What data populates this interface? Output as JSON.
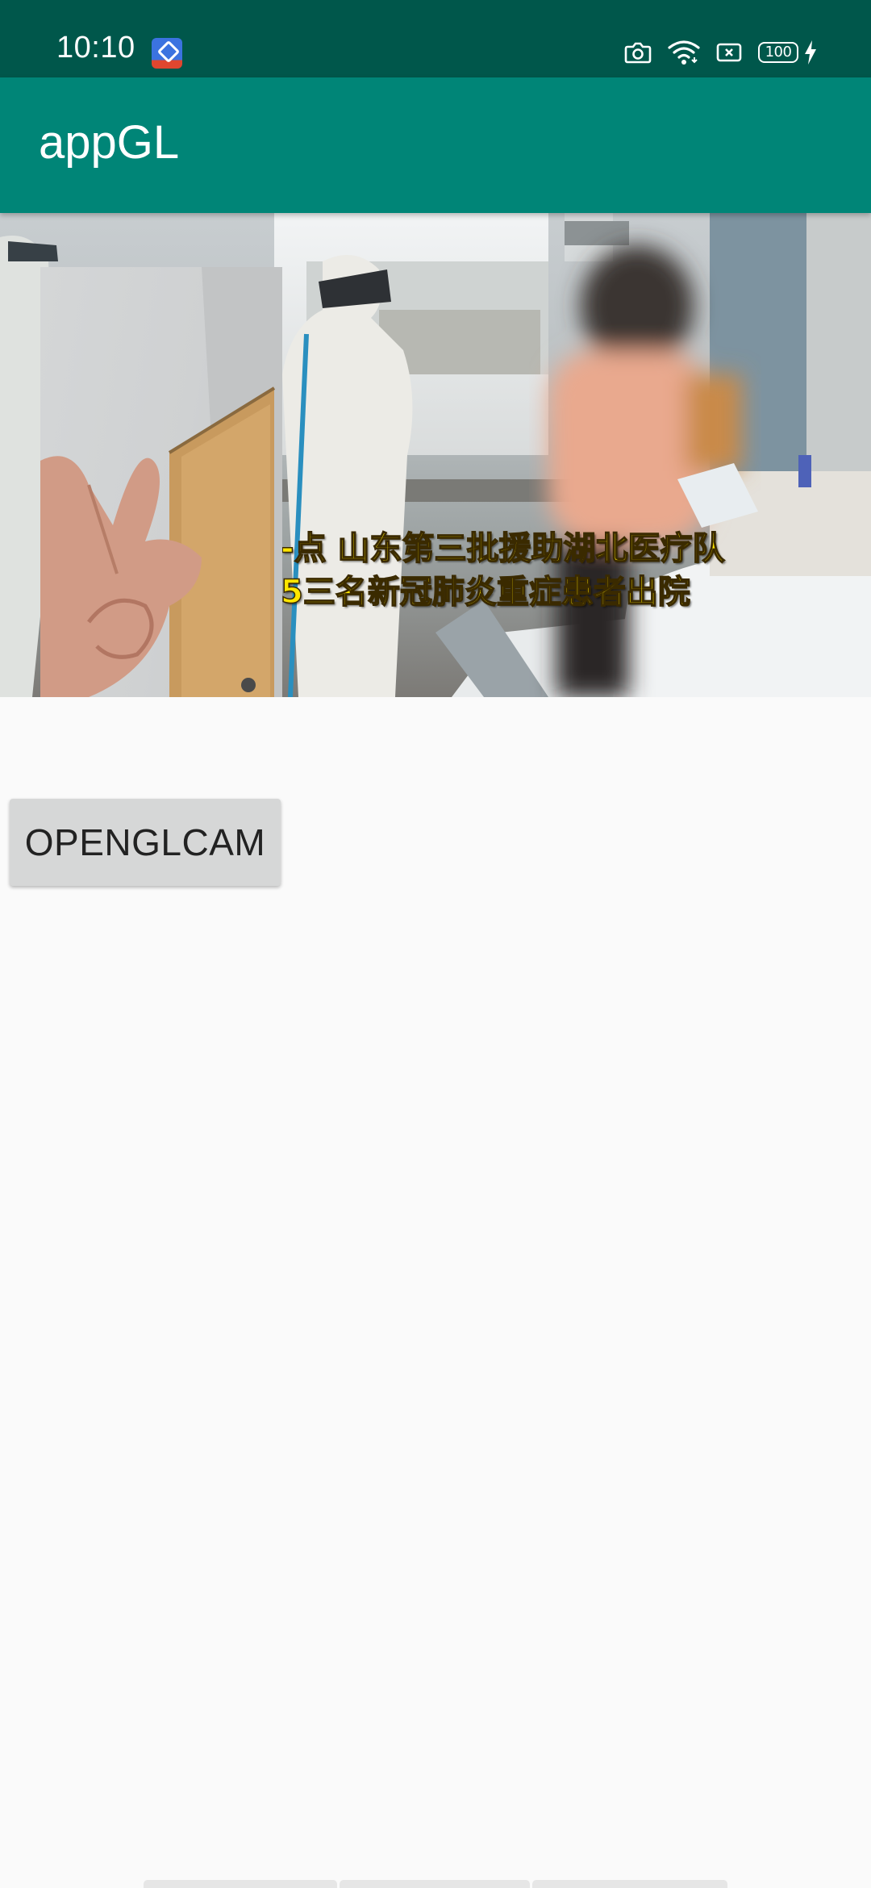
{
  "status_bar": {
    "time": "10:10",
    "notification_icon": "app-notification-icon",
    "icons": [
      "camera-icon",
      "wifi-icon",
      "no-sim-icon",
      "battery-icon",
      "charging-icon"
    ],
    "battery_level": "100"
  },
  "app_bar": {
    "title": "appGL"
  },
  "video": {
    "caption_line1": "-点 山东第三批援助湖北医疗队",
    "caption_line2": "5三名新冠肺炎重症患者出院"
  },
  "button": {
    "label": "OPENGLCAM"
  },
  "colors": {
    "status_bar": "#00574b",
    "app_bar": "#008577",
    "background": "#fafafa",
    "caption": "#ffe600"
  }
}
